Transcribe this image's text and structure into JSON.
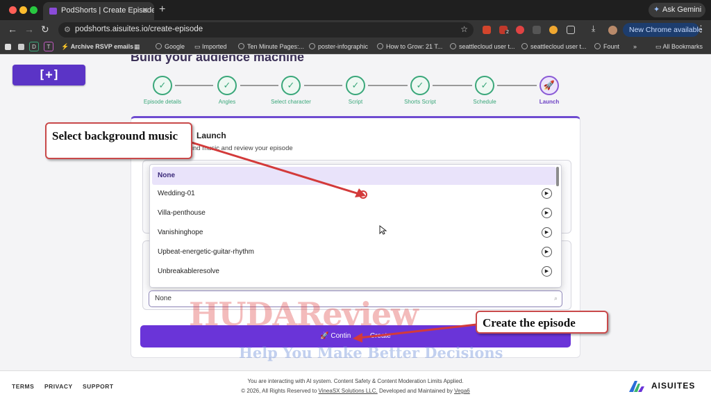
{
  "browser": {
    "tab_title": "PodShorts | Create Episode",
    "url": "podshorts.aisuites.io/create-episode",
    "ask_gemini": "Ask Gemini",
    "update_button": "New Chrome available",
    "ext_badge": "2",
    "bookmarks": [
      "Archive RSVP emails",
      "Google",
      "Imported",
      "Ten Minute Pages:...",
      "poster-infographic",
      "How to Grow: 21 T...",
      "seattlecloud user t...",
      "seattlecloud user t...",
      "Fount"
    ],
    "all_bookmarks": "All Bookmarks",
    "bookmark_letters": [
      "D",
      "T"
    ]
  },
  "app": {
    "brand_button": "[+]",
    "page_heading": "Build your audience machine",
    "steps": [
      {
        "label": "Episode details",
        "state": "done"
      },
      {
        "label": "Angles",
        "state": "done"
      },
      {
        "label": "Select character",
        "state": "done"
      },
      {
        "label": "Script",
        "state": "done"
      },
      {
        "label": "Shorts Script",
        "state": "done"
      },
      {
        "label": "Schedule",
        "state": "done"
      },
      {
        "label": "Launch",
        "state": "active"
      }
    ],
    "card_title": "Launch",
    "card_subtitle": "ground music and review your episode",
    "music_options": [
      "None",
      "Wedding-01",
      "Villa-penthouse",
      "Vanishinghope",
      "Upbeat-energetic-guitar-rhythm",
      "Unbreakableresolve"
    ],
    "search_value": "None",
    "continue_label": "Contin",
    "continue_label_end": "Create"
  },
  "annotations": {
    "callout_music": "Select background music",
    "callout_create": "Create the episode",
    "watermark_main": "HUDAReview",
    "watermark_sub": "Help You Make Better Decisions"
  },
  "footer": {
    "links": [
      "TERMS",
      "PRIVACY",
      "SUPPORT"
    ],
    "notice": "You are interacting with AI system. Content Safety & Content Moderation Limits Applied.",
    "copyright_prefix": "© 2026, All Rights Reserved to ",
    "company": "VineaSX Solutions LLC.",
    "copyright_mid": " Developed and Maintained by ",
    "dev": "Vega6",
    "brand": "AISUITES"
  },
  "colors": {
    "accent": "#6a34d8",
    "step_done": "#3aa77a",
    "callout_border": "#c9494a"
  }
}
